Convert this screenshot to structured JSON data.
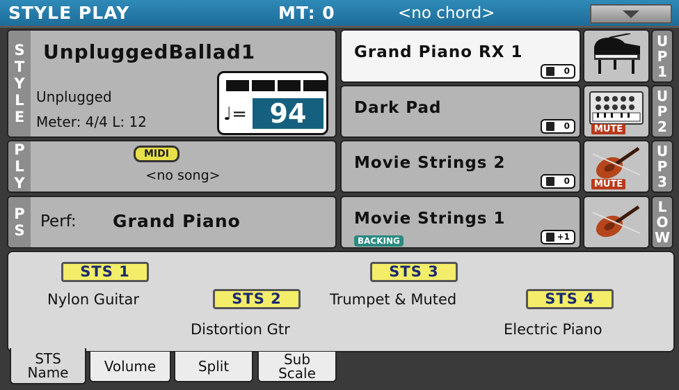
{
  "header": {
    "title": "STYLE PLAY",
    "mt": "MT: 0",
    "chord": "<no chord>"
  },
  "style": {
    "side": [
      "S",
      "T",
      "Y",
      "L",
      "E"
    ],
    "name": "UnpluggedBallad1",
    "category": "Unplugged",
    "meter": "Meter:  4/4   L:  12",
    "note": "♩=",
    "tempo": "94"
  },
  "player": {
    "side": [
      "P",
      "L",
      "Y"
    ],
    "badge": "MIDI",
    "song": "<no song>"
  },
  "perf": {
    "side": [
      "P",
      "S"
    ],
    "label": "Perf:",
    "name": "Grand Piano"
  },
  "sounds": [
    {
      "name": "Grand Piano RX 1",
      "octave": "0",
      "track": [
        "U",
        "P",
        "1"
      ]
    },
    {
      "name": "Dark Pad",
      "octave": "0",
      "track": [
        "U",
        "P",
        "2"
      ],
      "mute": "MUTE"
    },
    {
      "name": "Movie Strings 2",
      "octave": "0",
      "track": [
        "U",
        "P",
        "3"
      ],
      "mute": "MUTE"
    },
    {
      "name": "Movie Strings 1",
      "octave": "+1",
      "track": [
        "L",
        "O",
        "W"
      ],
      "backing": "BACKING"
    }
  ],
  "sts": [
    {
      "label": "STS 1",
      "name": "Nylon Guitar"
    },
    {
      "label": "STS 2",
      "name": "Distortion Gtr"
    },
    {
      "label": "STS 3",
      "name": "Trumpet & Muted"
    },
    {
      "label": "STS 4",
      "name": "Electric Piano"
    }
  ],
  "tabs": [
    {
      "line1": "STS",
      "line2": "Name"
    },
    {
      "line1": "Volume",
      "line2": ""
    },
    {
      "line1": "Split",
      "line2": ""
    },
    {
      "line1": "Sub",
      "line2": "Scale"
    }
  ],
  "colors": {
    "header": "#1d6d99",
    "tempo": "#16607f",
    "sts_button": "#f3ed6a",
    "mute": "#b83a1a",
    "backing": "#2a8a80"
  },
  "icons": [
    "menu-arrow-icon",
    "grand-piano-icon",
    "synth-pad-icon",
    "violin-icon",
    "octave-icon"
  ]
}
